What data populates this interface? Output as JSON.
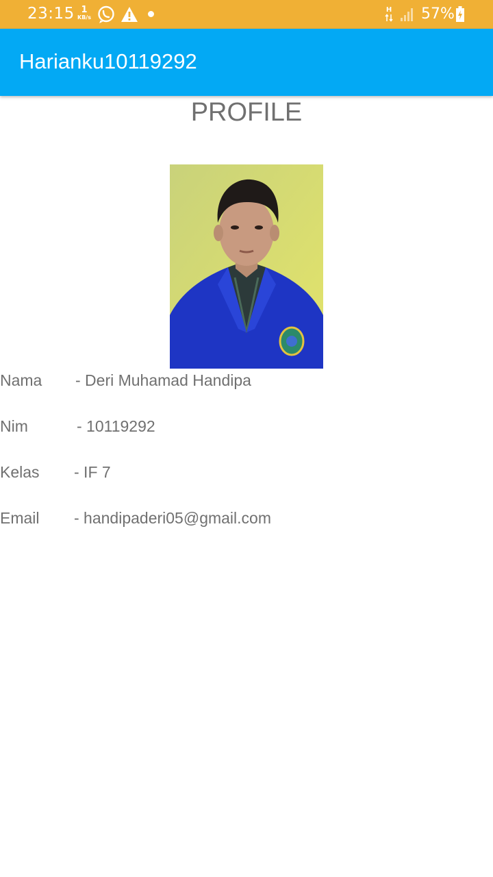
{
  "status_bar": {
    "time": "23:15",
    "net_speed_value": "1",
    "net_speed_unit": "KB/s",
    "network_type": "H",
    "battery_percent": "57%",
    "icons": [
      "whatsapp-icon",
      "warning-icon",
      "notification-dot-icon",
      "data-transfer-icon",
      "signal-icon",
      "battery-charging-icon"
    ],
    "background_color": "#f0b035"
  },
  "app_bar": {
    "title": "Harianku10119292",
    "background_color": "#03a9f4"
  },
  "page": {
    "heading": "PROFILE",
    "photo_icon": "profile-photo"
  },
  "profile": {
    "rows": [
      {
        "label": "Nama",
        "value": "- Deri Muhamad Handipa"
      },
      {
        "label": "Nim",
        "value": "- 10119292"
      },
      {
        "label": "Kelas",
        "value": "- IF 7"
      },
      {
        "label": "Email",
        "value": "- handipaderi05@gmail.com"
      }
    ]
  }
}
